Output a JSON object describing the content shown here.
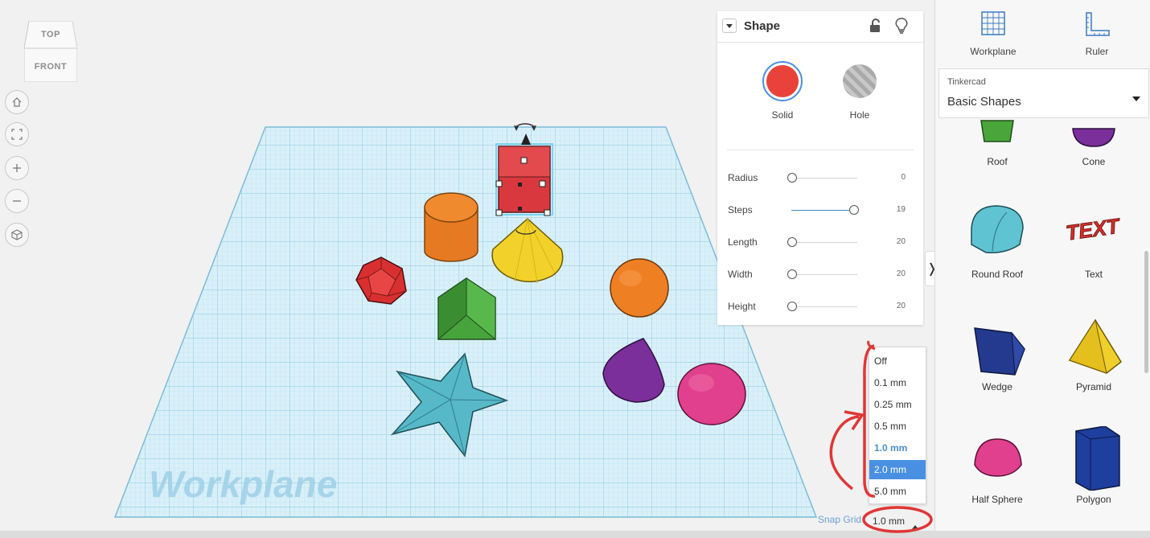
{
  "viewcube": {
    "top": "TOP",
    "front": "FRONT"
  },
  "workplane_watermark": "Workplane",
  "inspector": {
    "title": "Shape",
    "modes": [
      {
        "label": "Solid",
        "color": "#e8423a"
      },
      {
        "label": "Hole",
        "color": "#bdbdbd"
      }
    ],
    "properties": [
      {
        "label": "Radius",
        "value": "0",
        "level": 0.0
      },
      {
        "label": "Steps",
        "value": "19",
        "level": 0.94
      },
      {
        "label": "Length",
        "value": "20",
        "level": 0.0
      },
      {
        "label": "Width",
        "value": "20",
        "level": 0.0
      },
      {
        "label": "Height",
        "value": "20",
        "level": 0.0
      }
    ]
  },
  "snap_grid": {
    "label": "Snap Grid",
    "value": "1.0 mm",
    "options": [
      "Off",
      "0.1 mm",
      "0.25 mm",
      "0.5 mm",
      "1.0 mm",
      "2.0 mm",
      "5.0 mm"
    ],
    "selected": "1.0 mm",
    "highlighted": "2.0 mm"
  },
  "tools": [
    {
      "label": "Workplane",
      "icon": "workplane-grid-icon"
    },
    {
      "label": "Ruler",
      "icon": "ruler-icon"
    }
  ],
  "library": {
    "provider": "Tinkercad",
    "name": "Basic Shapes"
  },
  "shapes": [
    {
      "label": "Roof",
      "color": "#4aa63a"
    },
    {
      "label": "Cone",
      "color": "#7b2f9a"
    },
    {
      "label": "Round Roof",
      "color": "#5fc3d1"
    },
    {
      "label": "Text",
      "color": "#d4312c"
    },
    {
      "label": "Wedge",
      "color": "#233a8e"
    },
    {
      "label": "Pyramid",
      "color": "#f0cf2a"
    },
    {
      "label": "Half Sphere",
      "color": "#e0408e"
    },
    {
      "label": "Polygon",
      "color": "#1f3f9e"
    }
  ],
  "colors": {
    "accent": "#4a90e2",
    "annotation": "#e03636",
    "grid": "#aad9ec"
  }
}
